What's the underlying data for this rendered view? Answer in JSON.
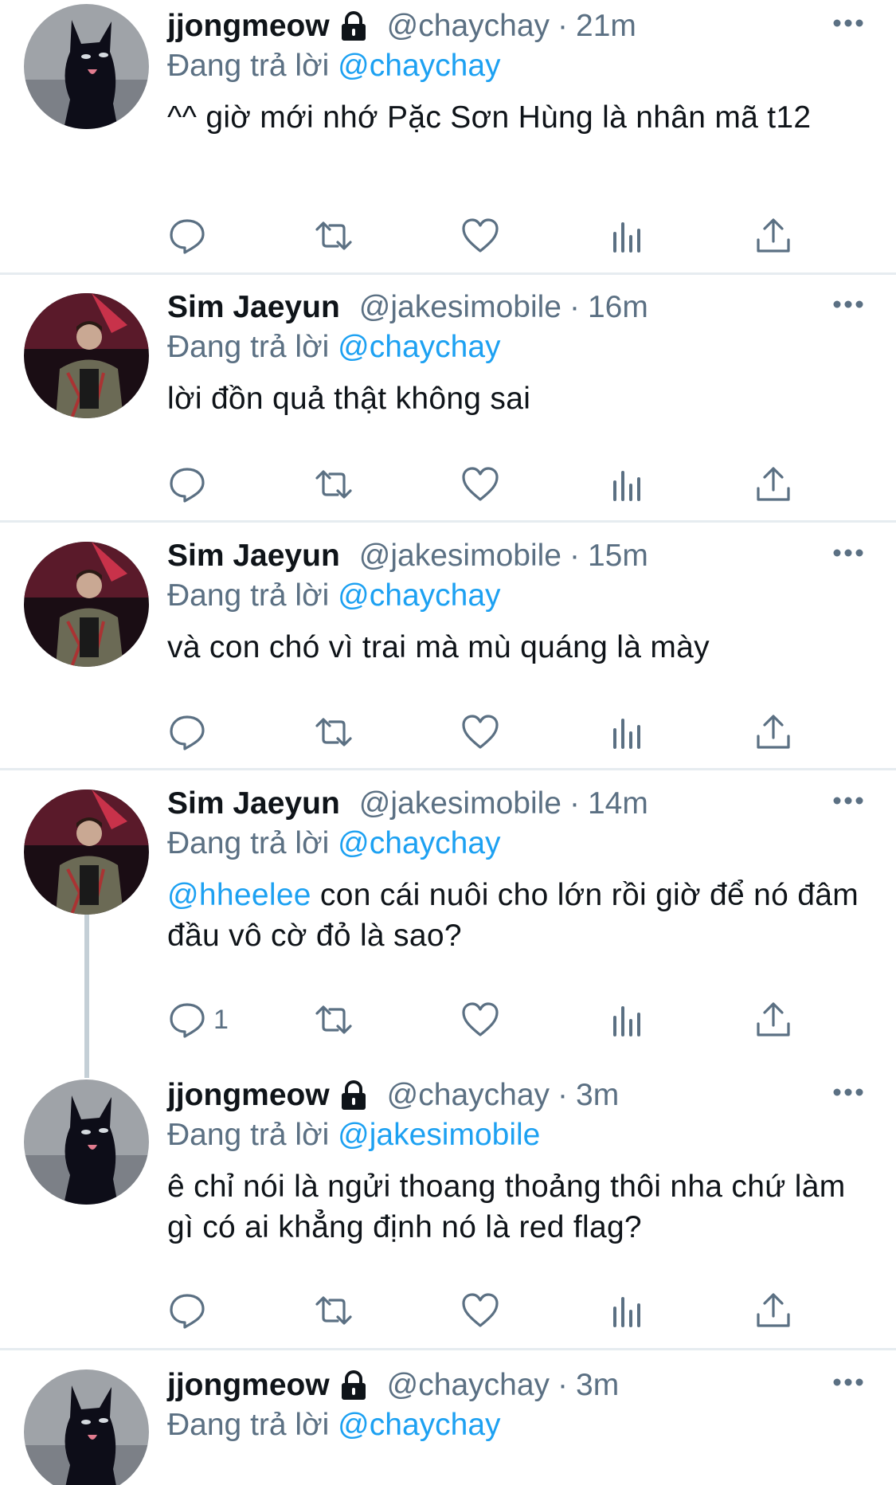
{
  "reply_prefix": "Đang trả lời",
  "tweets": [
    {
      "display_name": "jjongmeow",
      "locked": true,
      "handle": "@chaychay",
      "time": "21m",
      "reply_to": "@chaychay",
      "body": "^^ giờ mới nhớ Pặc Sơn Hùng là nhân mã t12",
      "reply_count": ""
    },
    {
      "display_name": "Sim Jaeyun",
      "locked": false,
      "handle": "@jakesimobile",
      "time": "16m",
      "reply_to": "@chaychay",
      "body": "lời đồn quả thật không sai",
      "reply_count": ""
    },
    {
      "display_name": "Sim Jaeyun",
      "locked": false,
      "handle": "@jakesimobile",
      "time": "15m",
      "reply_to": "@chaychay",
      "body": "và con chó vì trai mà mù quáng là mày",
      "reply_count": ""
    },
    {
      "display_name": "Sim Jaeyun",
      "locked": false,
      "handle": "@jakesimobile",
      "time": "14m",
      "reply_to": "@chaychay",
      "body_mention": "@hheelee",
      "body": " con cái nuôi cho lớn rồi giờ để nó đâm đầu vô cờ đỏ là sao?",
      "reply_count": "1"
    },
    {
      "display_name": "jjongmeow",
      "locked": true,
      "handle": "@chaychay",
      "time": "3m",
      "reply_to": "@jakesimobile",
      "body": "ê chỉ nói là ngửi thoang thoảng thôi nha chứ làm gì có ai khẳng định nó là red flag?",
      "reply_count": ""
    },
    {
      "display_name": "jjongmeow",
      "locked": true,
      "handle": "@chaychay",
      "time": "3m",
      "reply_to": "@chaychay",
      "body": "",
      "reply_count": ""
    }
  ],
  "icons": {
    "reply": "reply-icon",
    "retweet": "retweet-icon",
    "like": "heart-icon",
    "analytics": "analytics-icon",
    "share": "share-icon",
    "more": "more-icon",
    "lock": "lock-icon"
  },
  "colors": {
    "link": "#1da1f2",
    "secondary_text": "#5b7083",
    "divider": "#e6ecf0"
  }
}
